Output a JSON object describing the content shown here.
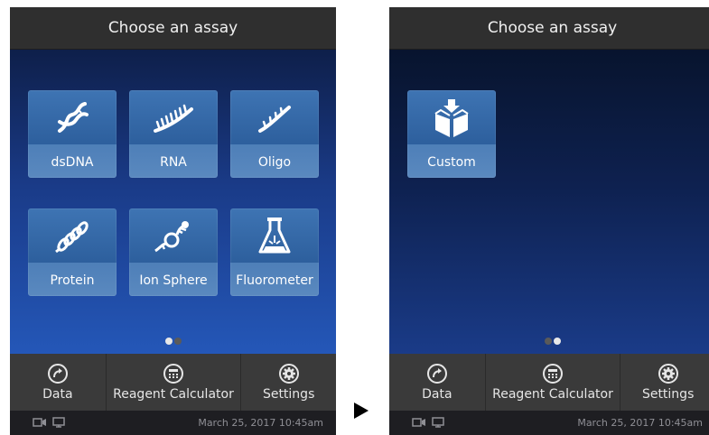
{
  "left_screen": {
    "title": "Choose an assay",
    "tiles": [
      {
        "label": "dsDNA",
        "icon": "dna-double-helix-icon"
      },
      {
        "label": "RNA",
        "icon": "rna-strand-icon"
      },
      {
        "label": "Oligo",
        "icon": "oligo-strand-icon"
      },
      {
        "label": "Protein",
        "icon": "protein-coil-icon"
      },
      {
        "label": "Ion Sphere",
        "icon": "ion-sphere-icon"
      },
      {
        "label": "Fluorometer",
        "icon": "flask-icon"
      }
    ],
    "page_indicator": {
      "active_page": 1,
      "total_pages": 2
    }
  },
  "right_screen": {
    "title": "Choose an assay",
    "tiles": [
      {
        "label": "Custom",
        "icon": "custom-box-icon"
      }
    ],
    "page_indicator": {
      "active_page": 2,
      "total_pages": 2
    }
  },
  "navbar": {
    "data_label": "Data",
    "calculator_label": "Reagent Calculator",
    "settings_label": "Settings"
  },
  "status_bar": {
    "datetime": "March 25, 2017 10:45am"
  },
  "colors": {
    "title_bar": "#2f2f2f",
    "tile": "#2d5f9d",
    "nav_bar": "#3a3a3a",
    "status_bar": "#1e1e22",
    "background_blue": "#1a3b88"
  }
}
